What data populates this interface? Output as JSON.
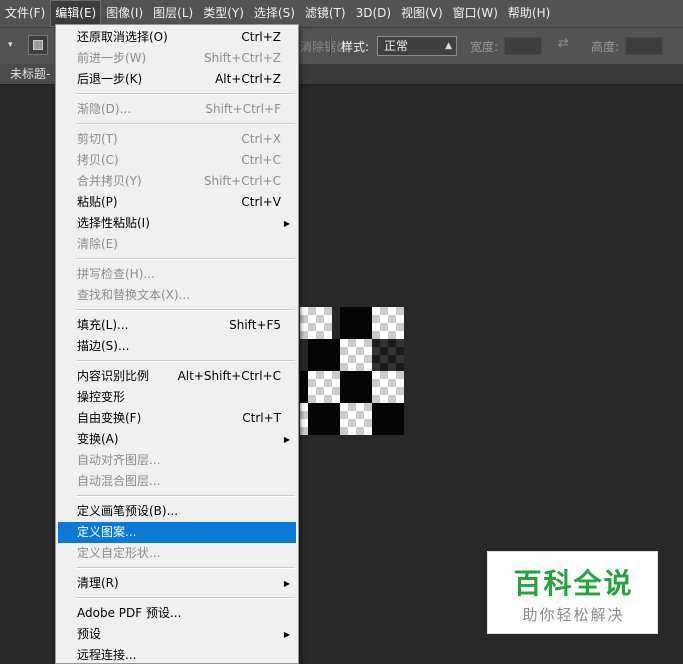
{
  "menubar": {
    "items": [
      "文件(F)",
      "编辑(E)",
      "图像(I)",
      "图层(L)",
      "类型(Y)",
      "选择(S)",
      "滤镜(T)",
      "3D(D)",
      "视图(V)",
      "窗口(W)",
      "帮助(H)"
    ],
    "active_index": 1
  },
  "options_bar": {
    "antialias": "消除锯齿",
    "style_label": "样式:",
    "style_value": "正常",
    "width_label": "宽度:",
    "height_label": "高度:"
  },
  "document": {
    "tab_title": "未标题-"
  },
  "edit_menu": {
    "items": [
      {
        "label": "还原取消选择(O)",
        "shortcut": "Ctrl+Z",
        "enabled": true
      },
      {
        "label": "前进一步(W)",
        "shortcut": "Shift+Ctrl+Z",
        "enabled": false
      },
      {
        "label": "后退一步(K)",
        "shortcut": "Alt+Ctrl+Z",
        "enabled": true
      },
      {
        "label": "渐隐(D)...",
        "shortcut": "Shift+Ctrl+F",
        "enabled": false
      },
      {
        "label": "剪切(T)",
        "shortcut": "Ctrl+X",
        "enabled": false
      },
      {
        "label": "拷贝(C)",
        "shortcut": "Ctrl+C",
        "enabled": false
      },
      {
        "label": "合并拷贝(Y)",
        "shortcut": "Shift+Ctrl+C",
        "enabled": false
      },
      {
        "label": "粘贴(P)",
        "shortcut": "Ctrl+V",
        "enabled": true
      },
      {
        "label": "选择性粘贴(I)",
        "shortcut": "",
        "enabled": true,
        "submenu": true
      },
      {
        "label": "清除(E)",
        "shortcut": "",
        "enabled": false
      },
      {
        "label": "拼写检查(H)...",
        "shortcut": "",
        "enabled": false
      },
      {
        "label": "查找和替换文本(X)...",
        "shortcut": "",
        "enabled": false
      },
      {
        "label": "填充(L)...",
        "shortcut": "Shift+F5",
        "enabled": true
      },
      {
        "label": "描边(S)...",
        "shortcut": "",
        "enabled": true
      },
      {
        "label": "内容识别比例",
        "shortcut": "Alt+Shift+Ctrl+C",
        "enabled": true
      },
      {
        "label": "操控变形",
        "shortcut": "",
        "enabled": true
      },
      {
        "label": "自由变换(F)",
        "shortcut": "Ctrl+T",
        "enabled": true
      },
      {
        "label": "变换(A)",
        "shortcut": "",
        "enabled": true,
        "submenu": true
      },
      {
        "label": "自动对齐图层...",
        "shortcut": "",
        "enabled": false
      },
      {
        "label": "自动混合图层...",
        "shortcut": "",
        "enabled": false
      },
      {
        "label": "定义画笔预设(B)...",
        "shortcut": "",
        "enabled": true
      },
      {
        "label": "定义图案...",
        "shortcut": "",
        "enabled": true,
        "highlighted": true
      },
      {
        "label": "定义自定形状...",
        "shortcut": "",
        "enabled": false
      },
      {
        "label": "清理(R)",
        "shortcut": "",
        "enabled": true,
        "submenu": true
      },
      {
        "label": "Adobe PDF 预设...",
        "shortcut": "",
        "enabled": true
      },
      {
        "label": "预设",
        "shortcut": "",
        "enabled": true,
        "submenu": true
      },
      {
        "label": "远程连接...",
        "shortcut": "",
        "enabled": true
      }
    ]
  },
  "watermark": {
    "title": "百科全说",
    "subtitle": "助你轻松解决"
  },
  "colors": {
    "accent": "#0a79d7",
    "menu_bg": "#f0f0f0",
    "app_bg": "#282828",
    "watermark_green": "#27a33d"
  }
}
